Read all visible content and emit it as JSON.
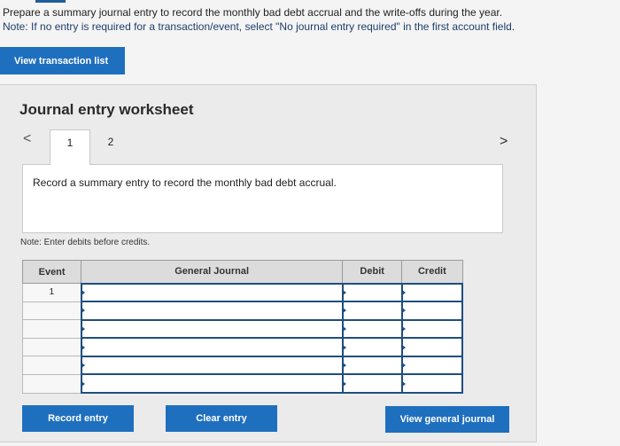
{
  "instructions": {
    "line1": "Prepare a summary journal entry to record the monthly bad debt accrual and the write-offs during the year.",
    "line2": "Note: If no entry is required for a transaction/event, select \"No journal entry required\" in the first account field."
  },
  "view_transaction_list_label": "View transaction list",
  "worksheet": {
    "title": "Journal entry worksheet",
    "tabs": [
      {
        "label": "1"
      },
      {
        "label": "2"
      }
    ],
    "prev_icon": "<",
    "next_icon": ">",
    "panel_text": "Record a summary entry to record the monthly bad debt accrual.",
    "note": "Note: Enter debits before credits.",
    "table": {
      "headers": {
        "event": "Event",
        "general_journal": "General Journal",
        "debit": "Debit",
        "credit": "Credit"
      },
      "rows": [
        {
          "event": "1",
          "account": "",
          "debit": "",
          "credit": ""
        },
        {
          "event": "",
          "account": "",
          "debit": "",
          "credit": ""
        },
        {
          "event": "",
          "account": "",
          "debit": "",
          "credit": ""
        },
        {
          "event": "",
          "account": "",
          "debit": "",
          "credit": ""
        },
        {
          "event": "",
          "account": "",
          "debit": "",
          "credit": ""
        },
        {
          "event": "",
          "account": "",
          "debit": "",
          "credit": ""
        }
      ]
    },
    "buttons": {
      "record_entry": "Record entry",
      "clear_entry": "Clear entry",
      "view_general_journal": "View general journal"
    }
  },
  "colors": {
    "primary_button": "#1f6fbf",
    "input_border": "#1f4e80"
  }
}
